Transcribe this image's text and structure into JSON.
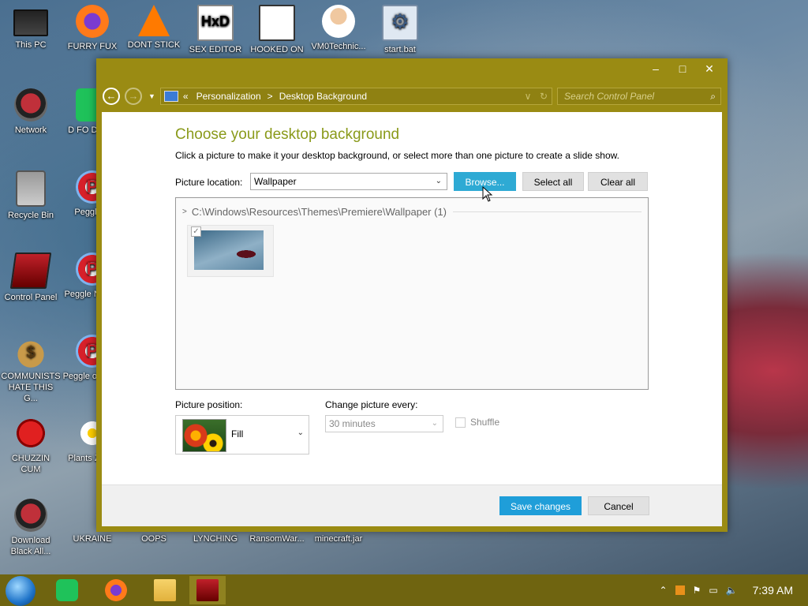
{
  "desktop": {
    "icons": [
      {
        "label": "This PC"
      },
      {
        "label": "FURRY FUX"
      },
      {
        "label": "DONT STICK"
      },
      {
        "label": "SEX EDITOR"
      },
      {
        "label": "HOOKED ON"
      },
      {
        "label": "VM0Technic..."
      },
      {
        "label": "start.bat"
      },
      {
        "label": "Network"
      },
      {
        "label": "D FO DUMB"
      },
      {
        "label": "Recycle Bin"
      },
      {
        "label": "Peggle D"
      },
      {
        "label": "Control Panel"
      },
      {
        "label": "Peggle N Delu"
      },
      {
        "label": "COMMUNISTS HATE THIS G..."
      },
      {
        "label": "Peggle of Wars"
      },
      {
        "label": "CHUZZIN CUM"
      },
      {
        "label": "Plants Zomb"
      },
      {
        "label": "Download Black All..."
      },
      {
        "label": "UKRAINE"
      },
      {
        "label": "OOPS"
      },
      {
        "label": "LYNCHING"
      },
      {
        "label": "RansomWar..."
      },
      {
        "label": "minecraft.jar"
      }
    ]
  },
  "window": {
    "controls": {
      "minimize": "–",
      "maximize": "□",
      "close": "✕"
    },
    "nav": {
      "back": "←",
      "forward": "→",
      "dropdown": "▼"
    },
    "address": {
      "prefix": "«",
      "crumbs": [
        "Personalization",
        "Desktop Background"
      ],
      "separator": ">",
      "dropdown": "∨",
      "refresh": "↻"
    },
    "search": {
      "placeholder": "Search Control Panel",
      "icon": "⌕"
    },
    "title": "Choose your desktop background",
    "subtitle": "Click a picture to make it your desktop background, or select more than one picture to create a slide show.",
    "location": {
      "label": "Picture location:",
      "value": "Wallpaper",
      "browse": "Browse...",
      "select_all": "Select all",
      "clear_all": "Clear all"
    },
    "gallery": {
      "group_path": "C:\\Windows\\Resources\\Themes\\Premiere\\Wallpaper (1)",
      "thumb_checked": "✓"
    },
    "position": {
      "label": "Picture position:",
      "value": "Fill"
    },
    "interval": {
      "label": "Change picture every:",
      "value": "30 minutes"
    },
    "shuffle": {
      "label": "Shuffle"
    },
    "footer": {
      "save": "Save changes",
      "cancel": "Cancel"
    }
  },
  "taskbar": {
    "clock": "7:39 AM",
    "tray_icons": [
      "chevron-up-icon",
      "app-icon",
      "flag-icon",
      "network-icon",
      "volume-icon"
    ]
  },
  "colors": {
    "window_frame": "#9a8b13",
    "accent": "#2eaad4",
    "title_text": "#8a9a1a",
    "taskbar": "#6f6410"
  }
}
